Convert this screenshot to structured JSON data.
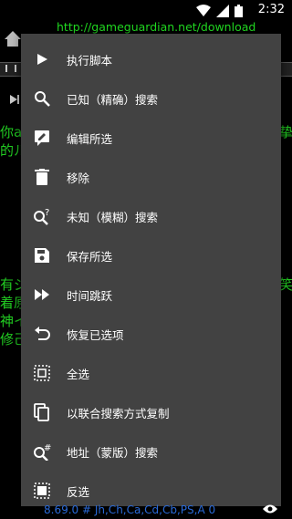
{
  "status": {
    "time": "2:32"
  },
  "url": "http://gameguardian.net/download",
  "background": {
    "left_text_1": "你a",
    "left_text_2": "的ル",
    "right_text_1": "挚心",
    "left_text_3": "有ジ",
    "left_text_4": "着原",
    "left_text_5": "神イ",
    "left_text_6": "修己",
    "right_text_2": "笑"
  },
  "menu": {
    "items": [
      {
        "label": "执行脚本",
        "icon": "play-icon"
      },
      {
        "label": "已知（精确）搜索",
        "icon": "search-icon"
      },
      {
        "label": "编辑所选",
        "icon": "edit-icon"
      },
      {
        "label": "移除",
        "icon": "trash-icon"
      },
      {
        "label": "未知（模糊）搜索",
        "icon": "fuzzy-search-icon"
      },
      {
        "label": "保存所选",
        "icon": "save-icon"
      },
      {
        "label": "时间跳跃",
        "icon": "fast-forward-icon"
      },
      {
        "label": "恢复已选项",
        "icon": "undo-icon"
      },
      {
        "label": "全选",
        "icon": "select-all-icon"
      },
      {
        "label": "以联合搜索方式复制",
        "icon": "copy-icon"
      },
      {
        "label": "地址（蒙版）搜索",
        "icon": "address-search-icon"
      },
      {
        "label": "反选",
        "icon": "invert-selection-icon"
      }
    ]
  },
  "bottom": {
    "text": "8.69.0 # Jh,Ch,Ca,Cd,Cb,PS,A 0"
  }
}
